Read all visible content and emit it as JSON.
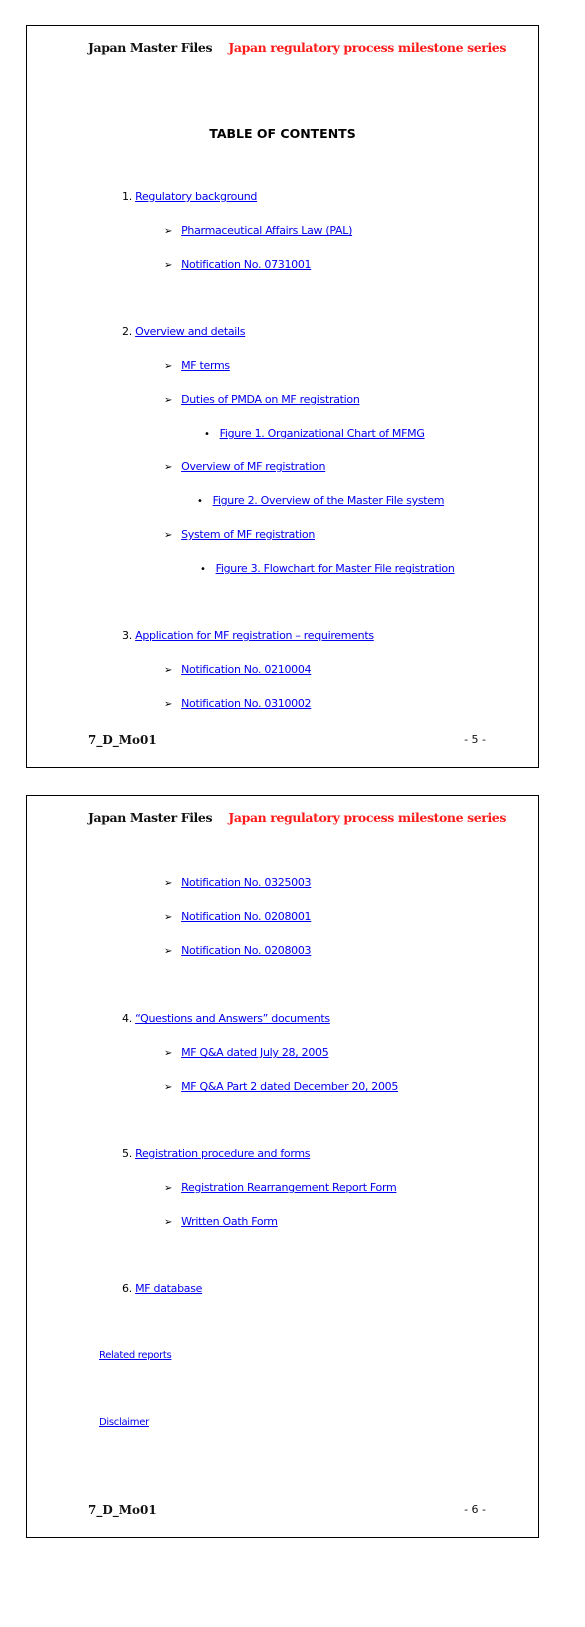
{
  "header": {
    "left": "Japan Master Files",
    "right": "Japan regulatory process milestone series",
    "right_color": "#ff1a1a"
  },
  "footer": {
    "doc_code": "7_D_Mo01"
  },
  "pages": [
    {
      "page_number": "- 5 -",
      "title": "TABLE OF CONTENTS",
      "items": {
        "s1": {
          "num": "1.",
          "label": "Regulatory background"
        },
        "s1a": {
          "marker": "arrow-bullet-icon",
          "label": "Pharmaceutical Affairs Law (PAL)"
        },
        "s1b": {
          "marker": "arrow-bullet-icon",
          "label": "Notification No. 0731001"
        },
        "s2": {
          "num": "2.",
          "label": "Overview and details"
        },
        "s2a": {
          "marker": "arrow-bullet-icon",
          "label": "MF terms"
        },
        "s2b": {
          "marker": "arrow-bullet-icon",
          "label": "Duties of PMDA on MF registration"
        },
        "s2b1": {
          "marker": "dot-bullet-icon",
          "label": "Figure 1. Organizational Chart of MFMG"
        },
        "s2c": {
          "marker": "arrow-bullet-icon",
          "label": "Overview of MF registration"
        },
        "s2c1": {
          "marker": "dot-bullet-icon",
          "label": "Figure 2. Overview of the Master File system"
        },
        "s2d": {
          "marker": "arrow-bullet-icon",
          "label": "System of MF registration"
        },
        "s2d1": {
          "marker": "dot-bullet-icon",
          "label": "Figure 3. Flowchart for Master File registration"
        },
        "s3": {
          "num": "3.",
          "label": "Application for MF registration – requirements"
        },
        "s3a": {
          "marker": "arrow-bullet-icon",
          "label": "Notification No. 0210004"
        },
        "s3b": {
          "marker": "arrow-bullet-icon",
          "label": "Notification No. 0310002"
        }
      }
    },
    {
      "page_number": "- 6 -",
      "items": {
        "s3c": {
          "marker": "arrow-bullet-icon",
          "label": "Notification No. 0325003"
        },
        "s3d": {
          "marker": "arrow-bullet-icon",
          "label": "Notification No. 0208001"
        },
        "s3e": {
          "marker": "arrow-bullet-icon",
          "label": "Notification No. 0208003"
        },
        "s4": {
          "num": "4.",
          "label": "“Questions and Answers” documents"
        },
        "s4a": {
          "marker": "arrow-bullet-icon",
          "label": "MF Q&A dated July 28, 2005"
        },
        "s4b": {
          "marker": "arrow-bullet-icon",
          "label": "MF Q&A Part 2 dated December 20, 2005"
        },
        "s5": {
          "num": "5.",
          "label": "Registration procedure and forms"
        },
        "s5a": {
          "marker": "arrow-bullet-icon",
          "label": "Registration Rearrangement Report Form"
        },
        "s5b": {
          "marker": "arrow-bullet-icon",
          "label": "Written Oath Form"
        },
        "s6": {
          "num": "6.",
          "label": "MF database"
        },
        "related": {
          "label": "Related reports"
        },
        "disclaimer": {
          "label": "Disclaimer"
        }
      }
    }
  ],
  "glyphs": {
    "arrow": "➢",
    "dot": "•"
  },
  "colors": {
    "link": "#0000ee",
    "text": "#000000"
  }
}
